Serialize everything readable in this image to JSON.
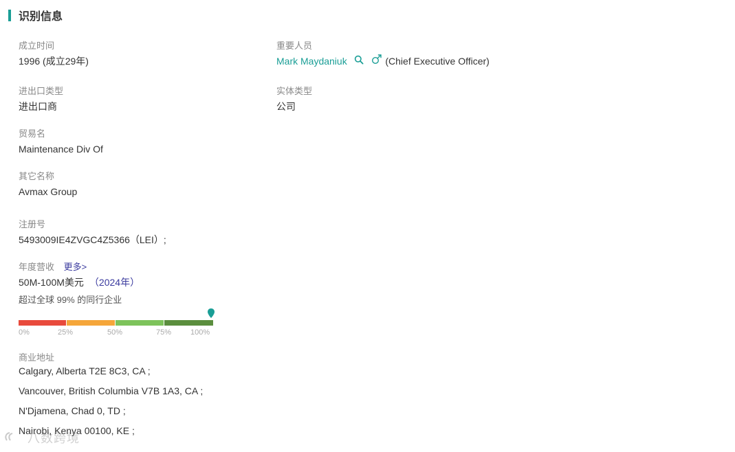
{
  "section": {
    "title": "识别信息"
  },
  "founded": {
    "label": "成立时间",
    "value": "1996 (成立29年)"
  },
  "key_person": {
    "label": "重要人员",
    "name": "Mark Maydaniuk",
    "role": "(Chief Executive Officer)",
    "gender_icon": "male-icon",
    "search_icon": "search-icon"
  },
  "import_export": {
    "label": "进出口类型",
    "value": "进出口商"
  },
  "entity_type": {
    "label": "实体类型",
    "value": "公司"
  },
  "trade_name": {
    "label": "贸易名",
    "value": "Maintenance Div Of"
  },
  "other_names": {
    "label": "其它名称",
    "value": "Avmax Group"
  },
  "registration": {
    "label": "注册号",
    "value": "5493009IE4ZVGC4Z5366（LEI）;"
  },
  "revenue": {
    "label": "年度营收",
    "more": "更多>",
    "value": "50M-100M美元",
    "year": "（2024年）",
    "rank_text": "超过全球 99% 的同行企业",
    "percentile": 0.99,
    "ticks": [
      "0%",
      "25%",
      "50%",
      "75%",
      "100%"
    ],
    "colors": [
      "#e84a3c",
      "#f5a63a",
      "#7dc35b",
      "#5b8e3e"
    ],
    "marker_color": "#1a9e96"
  },
  "address": {
    "label": "商业地址",
    "lines": [
      "Calgary, Alberta T2E 8C3, CA ;",
      "Vancouver, British Columbia V7B 1A3, CA ;",
      "N'Djamena, Chad 0, TD ;",
      "Nairobi, Kenya 00100, KE ;"
    ]
  },
  "watermark": "八数跨境"
}
